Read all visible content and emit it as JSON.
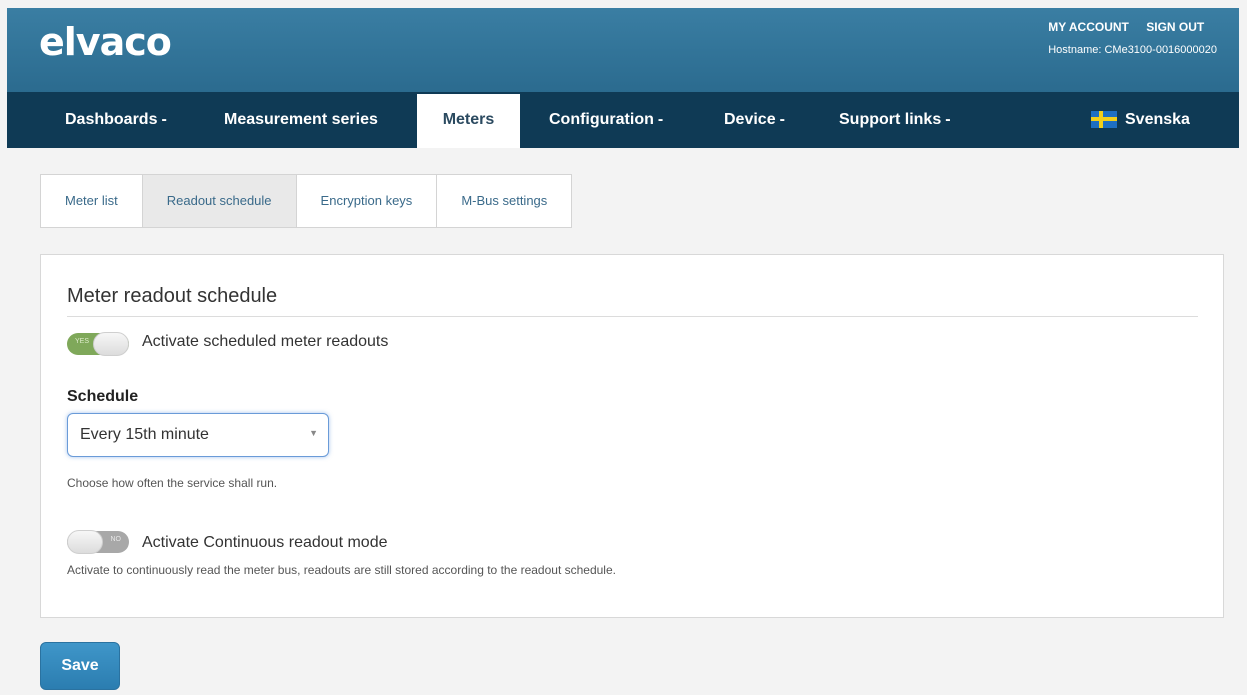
{
  "header": {
    "logo": "elvaco",
    "my_account": "MY ACCOUNT",
    "sign_out": "SIGN OUT",
    "hostname": "Hostname: CMe3100-0016000020"
  },
  "nav": {
    "dashboards": "Dashboards",
    "measurement_series": "Measurement series",
    "meters": "Meters",
    "configuration": "Configuration",
    "device": "Device",
    "support_links": "Support links",
    "language": "Svenska",
    "caret": "-"
  },
  "subtabs": {
    "meter_list": "Meter list",
    "readout_schedule": "Readout schedule",
    "encryption_keys": "Encryption keys",
    "mbus_settings": "M-Bus settings"
  },
  "panel": {
    "title": "Meter readout schedule",
    "toggle_scheduled": {
      "state": "YES",
      "label": "Activate scheduled meter readouts",
      "on": true
    },
    "schedule_label": "Schedule",
    "schedule_value": "Every 15th minute",
    "schedule_help": "Choose how often the service shall run.",
    "toggle_continuous": {
      "state": "NO",
      "label": "Activate Continuous readout mode",
      "on": false
    },
    "continuous_help": "Activate to continuously read the meter bus, readouts are still stored according to the readout schedule."
  },
  "save_label": "Save",
  "colors": {
    "header": "#3a7ea3",
    "nav": "#0f3a55",
    "accent": "#2b7db0",
    "toggle_on": "#7fa85a"
  }
}
